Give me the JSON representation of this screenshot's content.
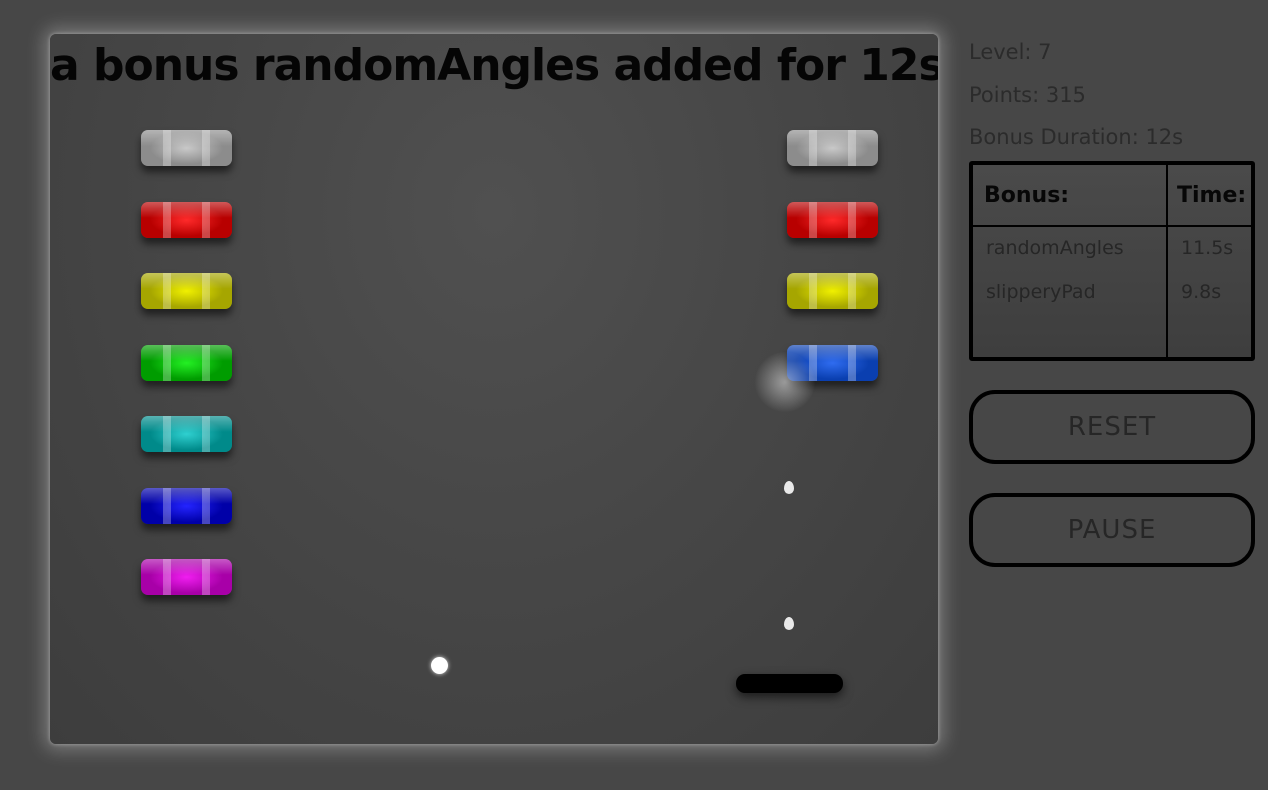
{
  "game": {
    "message": "a bonus randomAngles added for 12s",
    "bricks_left_column": [
      {
        "color": "#8c8c8c",
        "highlight": "#c9c9c9"
      },
      {
        "color": "#b80000",
        "highlight": "#ff2a2a"
      },
      {
        "color": "#a6a600",
        "highlight": "#f0f000"
      },
      {
        "color": "#009c00",
        "highlight": "#24f024"
      },
      {
        "color": "#008a8a",
        "highlight": "#2fd0d0"
      },
      {
        "color": "#0000a8",
        "highlight": "#2424ff"
      },
      {
        "color": "#a800a8",
        "highlight": "#f01ef0"
      }
    ],
    "bricks_right_column": [
      {
        "color": "#8c8c8c",
        "highlight": "#c9c9c9"
      },
      {
        "color": "#b80000",
        "highlight": "#ff2a2a"
      },
      {
        "color": "#a6a600",
        "highlight": "#f0f000"
      },
      {
        "color": "#0a3fb0",
        "highlight": "#2f6cf0"
      }
    ]
  },
  "sidebar": {
    "level": "Level: 7",
    "points": "Points: 315",
    "bonus_duration": "Bonus Duration: 12s",
    "bonus_table": {
      "header_bonus": "Bonus:",
      "header_time": "Time:",
      "rows": [
        {
          "bonus": "randomAngles",
          "time": "11.5s"
        },
        {
          "bonus": "slipperyPad",
          "time": "9.8s"
        }
      ]
    },
    "reset_label": "RESET",
    "pause_label": "PAUSE"
  }
}
